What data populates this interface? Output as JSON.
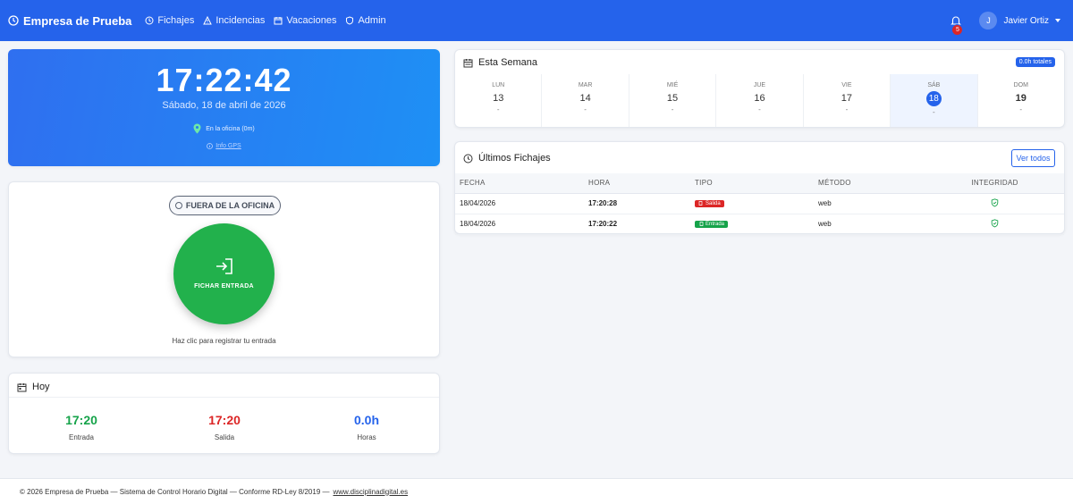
{
  "nav": {
    "brand": "Empresa de Prueba",
    "links": [
      {
        "label": "Fichajes",
        "icon": "clock-icon"
      },
      {
        "label": "Incidencias",
        "icon": "warning-icon"
      },
      {
        "label": "Vacaciones",
        "icon": "calendar-icon"
      },
      {
        "label": "Admin",
        "icon": "shield-icon"
      }
    ],
    "notifications": "5",
    "user_initial": "J",
    "user_name": "Javier Ortiz"
  },
  "clock": {
    "time": "17:22:42",
    "date": "Sábado, 18 de abril de 2026",
    "location": "En la oficina (0m)",
    "gps": "Info GPS"
  },
  "punch": {
    "status": "FUERA DE LA OFICINA",
    "button": "FICHAR ENTRADA",
    "hint": "Haz clic para registrar tu entrada"
  },
  "today": {
    "title": "Hoy",
    "entrada_value": "17:20",
    "entrada_label": "Entrada",
    "salida_value": "17:20",
    "salida_label": "Salida",
    "horas_value": "0.0h",
    "horas_label": "Horas"
  },
  "week": {
    "title": "Esta Semana",
    "total": "0.0h totales",
    "days": [
      {
        "name": "LUN",
        "num": "13",
        "hours": "-"
      },
      {
        "name": "MAR",
        "num": "14",
        "hours": "-"
      },
      {
        "name": "MIÉ",
        "num": "15",
        "hours": "-"
      },
      {
        "name": "JUE",
        "num": "16",
        "hours": "-"
      },
      {
        "name": "VIE",
        "num": "17",
        "hours": "-"
      },
      {
        "name": "SÁB",
        "num": "18",
        "hours": "-"
      },
      {
        "name": "DOM",
        "num": "19",
        "hours": "-"
      }
    ]
  },
  "last": {
    "title": "Últimos Fichajes",
    "view_all": "Ver todos",
    "columns": [
      "FECHA",
      "HORA",
      "TIPO",
      "MÉTODO",
      "INTEGRIDAD"
    ],
    "rows": [
      {
        "fecha": "18/04/2026",
        "hora": "17:20:28",
        "tipo": "Salida",
        "metodo": "web"
      },
      {
        "fecha": "18/04/2026",
        "hora": "17:20:22",
        "tipo": "Entrada",
        "metodo": "web"
      }
    ]
  },
  "footer": {
    "text": "© 2026 Empresa de Prueba — Sistema de Control Horario Digital — Conforme RD-Ley 8/2019 —",
    "link": "www.disciplinadigital.es"
  },
  "colors": {
    "primary": "#2563eb",
    "success": "#22b14c",
    "danger": "#dc2626"
  }
}
